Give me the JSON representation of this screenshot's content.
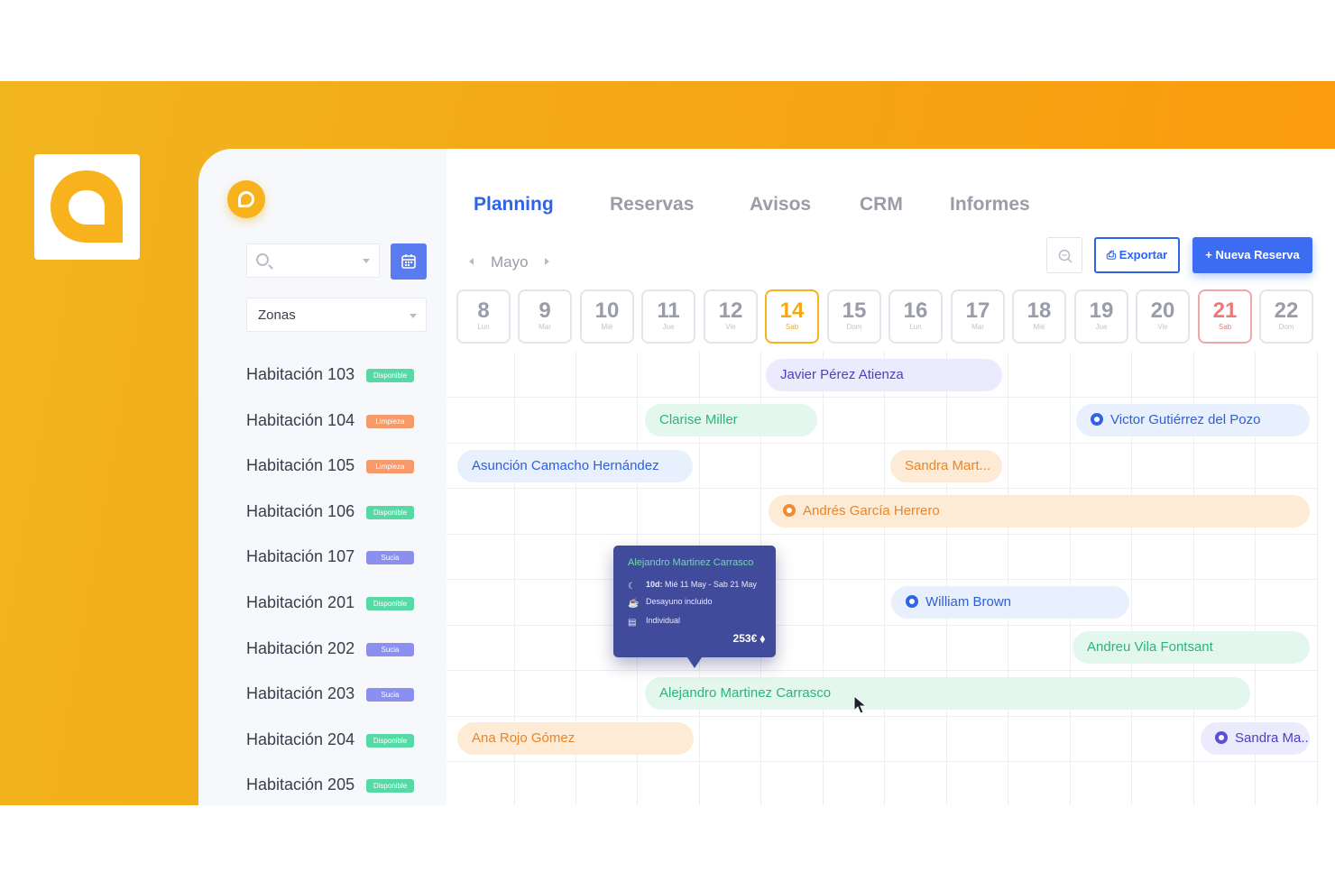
{
  "brand": {
    "accent": "#f7b21d",
    "primary": "#2f63e8"
  },
  "nav": {
    "tabs": [
      {
        "label": "Planning",
        "active": true
      },
      {
        "label": "Reservas",
        "active": false
      },
      {
        "label": "Avisos",
        "active": false
      },
      {
        "label": "CRM",
        "active": false
      },
      {
        "label": "Informes",
        "active": false
      }
    ]
  },
  "sidebar": {
    "search_placeholder": "",
    "zones_label": "Zonas",
    "rooms": [
      {
        "name": "Habitación 103",
        "status": "Disponible",
        "color": "#56d9a4"
      },
      {
        "name": "Habitación 104",
        "status": "Limpieza",
        "color": "#f59a6b"
      },
      {
        "name": "Habitación 105",
        "status": "Limpieza",
        "color": "#f59a6b"
      },
      {
        "name": "Habitación 106",
        "status": "Disponible",
        "color": "#56d9a4"
      },
      {
        "name": "Habitación 107",
        "status": "Sucia",
        "color": "#8b8ff0"
      },
      {
        "name": "Habitación 201",
        "status": "Disponible",
        "color": "#56d9a4"
      },
      {
        "name": "Habitación 202",
        "status": "Sucia",
        "color": "#8b8ff0"
      },
      {
        "name": "Habitación 203",
        "status": "Sucia",
        "color": "#8b8ff0"
      },
      {
        "name": "Habitación 204",
        "status": "Disponible",
        "color": "#56d9a4"
      },
      {
        "name": "Habitación 205",
        "status": "Disponible",
        "color": "#56d9a4"
      }
    ]
  },
  "calendar": {
    "month": "Mayo",
    "days": [
      {
        "num": "8",
        "dow": "Lun"
      },
      {
        "num": "9",
        "dow": "Mar"
      },
      {
        "num": "10",
        "dow": "Mié"
      },
      {
        "num": "11",
        "dow": "Jue"
      },
      {
        "num": "12",
        "dow": "Vie"
      },
      {
        "num": "14",
        "dow": "Sab",
        "state": "today"
      },
      {
        "num": "15",
        "dow": "Dom"
      },
      {
        "num": "16",
        "dow": "Lun"
      },
      {
        "num": "17",
        "dow": "Mar"
      },
      {
        "num": "18",
        "dow": "Mié"
      },
      {
        "num": "19",
        "dow": "Jue"
      },
      {
        "num": "20",
        "dow": "Vie"
      },
      {
        "num": "21",
        "dow": "Sab",
        "state": "weekend"
      },
      {
        "num": "22",
        "dow": "Dom"
      }
    ]
  },
  "toolbar": {
    "export_label": "Exportar",
    "new_label": "+ Nueva Reserva"
  },
  "bookings": [
    {
      "guest": "Javier Pérez Atienza",
      "theme": "purple",
      "icon": false
    },
    {
      "guest": "Clarise Miller",
      "theme": "green",
      "icon": false
    },
    {
      "guest": "Victor Gutiérrez del Pozo",
      "theme": "blue",
      "icon": "euro-icon"
    },
    {
      "guest": "Asunción Camacho Hernández",
      "theme": "blue",
      "icon": false
    },
    {
      "guest": "Sandra Mart...",
      "theme": "orange",
      "icon": false
    },
    {
      "guest": "Andrés García Herrero",
      "theme": "orange",
      "icon": "status-dot-icon"
    },
    {
      "guest": "William Brown",
      "theme": "blue",
      "icon": "status-dot-icon"
    },
    {
      "guest": "Andreu Vila Fontsant",
      "theme": "green",
      "icon": false
    },
    {
      "guest": "Alejandro Martinez Carrasco",
      "theme": "green",
      "icon": false
    },
    {
      "guest": "Ana Rojo Gómez",
      "theme": "orange",
      "icon": false
    },
    {
      "guest": "Sandra Ma...",
      "theme": "purple",
      "icon": "status-dot-icon"
    }
  ],
  "themes": {
    "purple": {
      "bg": "#ecebfd",
      "fg": "#4a3fc7",
      "icon": "#5a4fd6"
    },
    "green": {
      "bg": "#e3f7ee",
      "fg": "#2db47a",
      "icon": "#2db47a"
    },
    "blue": {
      "bg": "#e8effd",
      "fg": "#2f5fd6",
      "icon": "#2f63e8"
    },
    "orange": {
      "bg": "#fdebd6",
      "fg": "#e7862d",
      "icon": "#f28a2f"
    }
  },
  "tooltip": {
    "name": "Alejandro Martinez Carrasco",
    "stay_bold": "10d:",
    "stay": "Mié 11 May - Sab 21 May",
    "board": "Desayuno incluido",
    "room_type": "Individual",
    "price": "253€"
  }
}
